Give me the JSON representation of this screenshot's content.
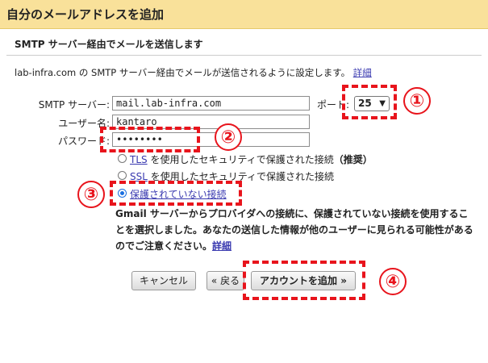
{
  "title": "自分のメールアドレスを追加",
  "subtitle": "SMTP サーバー経由でメールを送信します",
  "intro": {
    "text": "lab-infra.com の SMTP サーバー経由でメールが送信されるように設定します。",
    "link": "詳細"
  },
  "form": {
    "smtp_label": "SMTP サーバー:",
    "smtp_value": "mail.lab-infra.com",
    "port_label": "ポート:",
    "port_value": "25",
    "user_label": "ユーザー名:",
    "user_value": "kantaro",
    "pass_label": "パスワード:",
    "pass_value": "••••••••"
  },
  "options": {
    "tls_link": "TLS",
    "tls_text": " を使用したセキュリティで保護された接続",
    "tls_rec": "（推奨）",
    "ssl_link": "SSL",
    "ssl_text": " を使用したセキュリティで保護された接続",
    "unsecure": "保護されていない接続"
  },
  "warning": {
    "text": "Gmail サーバーからプロバイダへの接続に、保護されていない接続を使用することを選択しました。あなたの送信した情報が他のユーザーに見られる可能性があるのでご注意ください。",
    "link": "詳細"
  },
  "buttons": {
    "cancel": "キャンセル",
    "back": "« 戻る",
    "add": "アカウントを追加 »"
  },
  "annotations": [
    "①",
    "②",
    "③",
    "④"
  ],
  "colors": {
    "title_bg": "#f9e19a",
    "annotation": "#e8141c",
    "link": "#3a3ab0"
  }
}
